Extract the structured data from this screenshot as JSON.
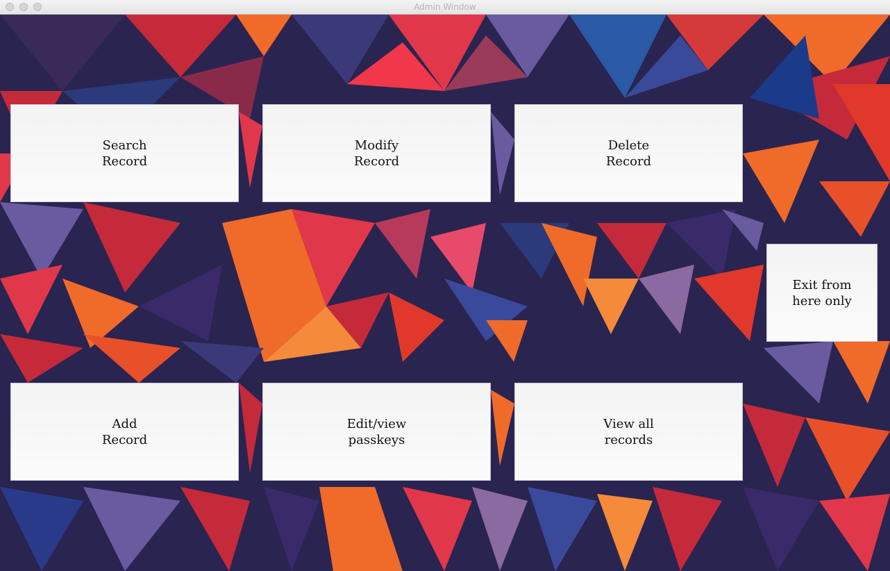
{
  "window": {
    "title": "Admin Window"
  },
  "buttons": {
    "search_record": "Search\nRecord",
    "modify_record": "Modify\nRecord",
    "delete_record": "Delete\nRecord",
    "exit": "Exit from\nhere only",
    "add_record": "Add\nRecord",
    "edit_passkeys": "Edit/view\npasskeys",
    "view_all_records": "View all\nrecords"
  },
  "colors": {
    "background_base": "#2a2450",
    "accent_orange": "#f06a2a",
    "accent_red": "#c42a3a",
    "accent_blue": "#2a5aa6",
    "accent_purple": "#6a5aa0"
  }
}
